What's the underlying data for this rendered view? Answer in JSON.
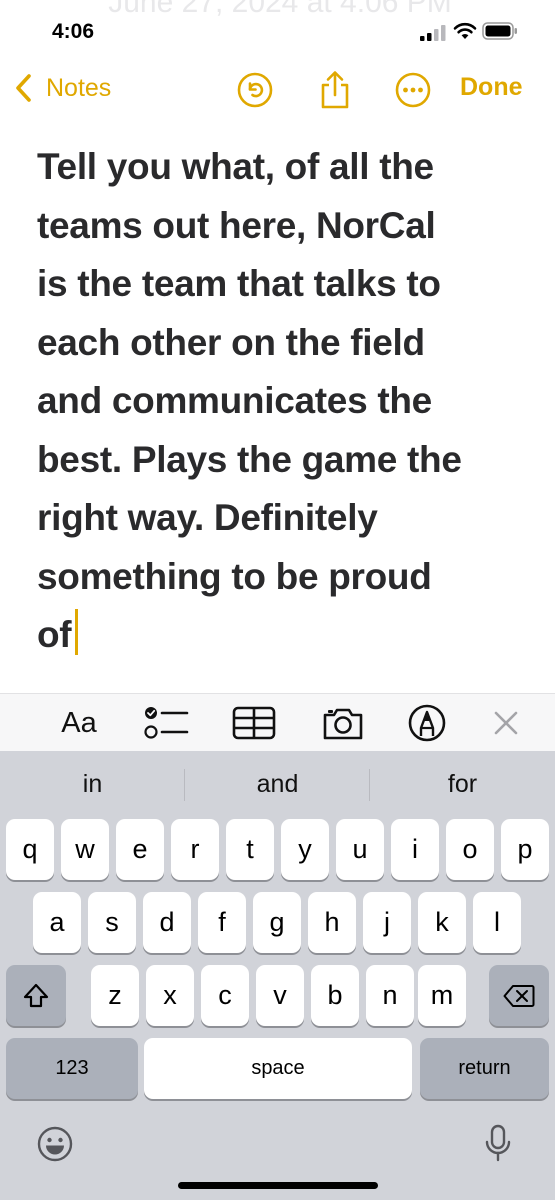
{
  "status": {
    "background_date": "June 27, 2024 at 4:06 PM",
    "time": "4:06"
  },
  "nav": {
    "back_label": "Notes",
    "done_label": "Done",
    "icons": [
      "undo-icon",
      "share-icon",
      "more-icon"
    ]
  },
  "note": {
    "text": "Tell you what, of all the\nteams out here, NorCal\nis the team that talks to\neach other on the field\nand communicates the\nbest. Plays the game the\nright way. Definitely\nsomething to be proud\nof"
  },
  "format_toolbar": {
    "text_style_label": "Aa",
    "icons": [
      "text-style-icon",
      "checklist-icon",
      "table-icon",
      "camera-icon",
      "markup-icon",
      "close-icon"
    ]
  },
  "keyboard": {
    "suggestions": [
      "in",
      "and",
      "for"
    ],
    "rows": [
      [
        "q",
        "w",
        "e",
        "r",
        "t",
        "y",
        "u",
        "i",
        "o",
        "p"
      ],
      [
        "a",
        "s",
        "d",
        "f",
        "g",
        "h",
        "j",
        "k",
        "l"
      ],
      [
        "z",
        "x",
        "c",
        "v",
        "b",
        "n",
        "m"
      ]
    ],
    "numbers_label": "123",
    "space_label": "space",
    "return_label": "return"
  },
  "colors": {
    "accent": "#e0a800",
    "keyboard_bg": "#d1d3d9",
    "key_dark": "#abb0ba"
  }
}
